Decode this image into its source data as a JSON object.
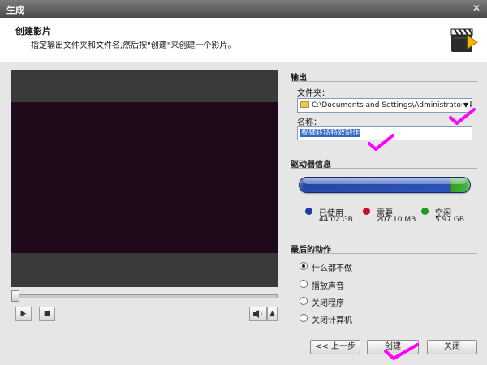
{
  "window": {
    "title": "生成",
    "close_label": "✕"
  },
  "header": {
    "title": "创建影片",
    "subtitle": "指定输出文件夹和文件名,然后按\"创建\"来创建一个影片。"
  },
  "output": {
    "section_title": "输出",
    "folder_label": "文件夹：",
    "folder_value": "C:\\Documents and Settings\\Administrator\\桌面",
    "name_label": "名称：",
    "name_value": "视频转场特效制作"
  },
  "drive": {
    "section_title": "驱动器信息",
    "used_label": "已使用",
    "used_value": "44.02 GB",
    "used_color": "#1b3fa0",
    "needed_label": "需要",
    "needed_value": "207.10 MB",
    "needed_color": "#c0142b",
    "free_label": "空闲",
    "free_value": "5.97 GB",
    "free_color": "#1f9a25",
    "used_fraction": 0.883
  },
  "last_action": {
    "section_title": "最后的动作",
    "options": [
      {
        "label": "什么都不做",
        "selected": true
      },
      {
        "label": "播放声音",
        "selected": false
      },
      {
        "label": "关闭程序",
        "selected": false
      },
      {
        "label": "关闭计算机",
        "selected": false
      }
    ]
  },
  "playback": {
    "play_icon": "play-icon",
    "stop_icon": "stop-icon",
    "volume_icon": "speaker-icon",
    "seek_position": 0
  },
  "footer": {
    "back_label": "<< 上一步",
    "create_label": "创建",
    "close_label": "关闭"
  },
  "accent_color": "#ff00ff"
}
